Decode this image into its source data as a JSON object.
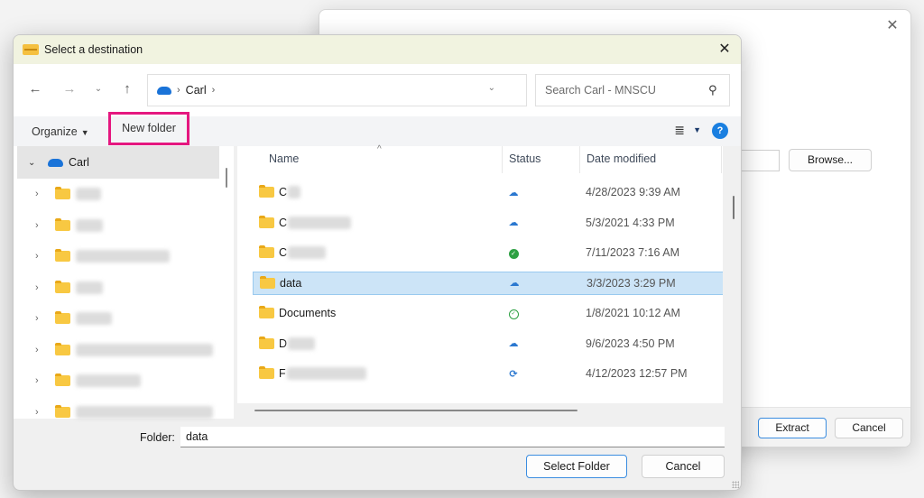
{
  "background_dialog": {
    "browse_label": "Browse...",
    "extract_label": "Extract",
    "cancel_label": "Cancel",
    "close_glyph": "✕"
  },
  "dialog": {
    "title": "Select a destination",
    "close_glyph": "✕",
    "nav": {
      "back_glyph": "←",
      "forward_glyph": "→",
      "recent_glyph": "⌄",
      "up_glyph": "↑",
      "breadcrumb": [
        "Carl"
      ],
      "separator": "›",
      "dropdown_glyph": "⌄",
      "refresh_glyph": "↻"
    },
    "search": {
      "placeholder": "Search Carl - MNSCU",
      "icon_glyph": "⚲"
    },
    "toolbar": {
      "organize_label": "Organize",
      "organize_caret": "▼",
      "new_folder_label": "New folder",
      "view_glyph": "≣",
      "view_caret": "▼",
      "help_glyph": "?",
      "highlight_color": "#e5177f"
    },
    "tree": {
      "root": {
        "label": "Carl",
        "expand_glyph": "⌄"
      },
      "child_expand_glyph": "›",
      "child_count_visible": 8
    },
    "list": {
      "columns": [
        "Name",
        "Status",
        "Date modified"
      ],
      "sort_glyph": "^",
      "rows": [
        {
          "name": "C",
          "status": "cloud",
          "date": "4/28/2023 9:39 AM",
          "blurred": true
        },
        {
          "name": "C",
          "status": "cloud",
          "date": "5/3/2021 4:33 PM",
          "blurred": true
        },
        {
          "name": "C",
          "status": "synced-filled",
          "date": "7/11/2023 7:16 AM",
          "blurred": true
        },
        {
          "name": "data",
          "status": "cloud",
          "date": "3/3/2023 3:29 PM",
          "selected": true
        },
        {
          "name": "Documents",
          "status": "synced-outline",
          "date": "1/8/2021 10:12 AM"
        },
        {
          "name": "D",
          "status": "cloud",
          "date": "9/6/2023 4:50 PM",
          "blurred": true
        },
        {
          "name": "F",
          "status": "syncing",
          "date": "4/12/2023 12:57 PM",
          "blurred": true
        }
      ],
      "status_glyphs": {
        "cloud": "☁",
        "synced-filled": "✓",
        "synced-outline": "✓",
        "syncing": "⟳"
      }
    },
    "footer": {
      "folder_label": "Folder:",
      "folder_value": "data",
      "select_label": "Select Folder",
      "cancel_label": "Cancel"
    }
  }
}
